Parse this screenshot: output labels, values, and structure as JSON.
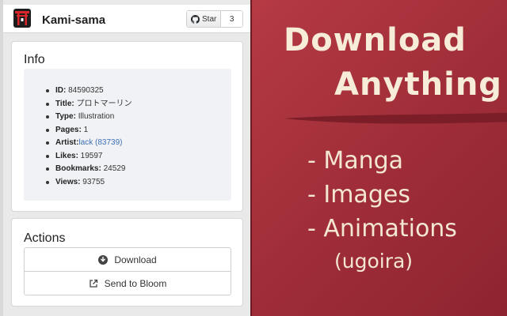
{
  "app": {
    "title": "Kami-sama",
    "github": {
      "star_label": "Star",
      "star_count": "3",
      "icon": "github-icon"
    },
    "logo": "torii-logo"
  },
  "info": {
    "title": "Info",
    "items": [
      {
        "key": "ID:",
        "value": " 84590325"
      },
      {
        "key": "Title:",
        "value": " プロトマーリン"
      },
      {
        "key": "Type:",
        "value": " Illustration"
      },
      {
        "key": "Pages:",
        "value": " 1"
      },
      {
        "key": "Artist:",
        "value": "lack (83739)",
        "is_link": true
      },
      {
        "key": "Likes:",
        "value": " 19597"
      },
      {
        "key": "Bookmarks:",
        "value": " 24529"
      },
      {
        "key": "Views:",
        "value": " 93755"
      }
    ]
  },
  "actions": {
    "title": "Actions",
    "download_label": "Download",
    "bloom_label": "Send to Bloom",
    "download_icon": "download-circle-icon",
    "bloom_icon": "external-link-icon"
  },
  "promo": {
    "line1": "Download",
    "line2": "Anything",
    "list": [
      "- Manga",
      "- Images",
      "- Animations"
    ],
    "note": "(ugoira)",
    "colors": {
      "background": "#a8323a",
      "text": "#f6ecd8"
    }
  }
}
